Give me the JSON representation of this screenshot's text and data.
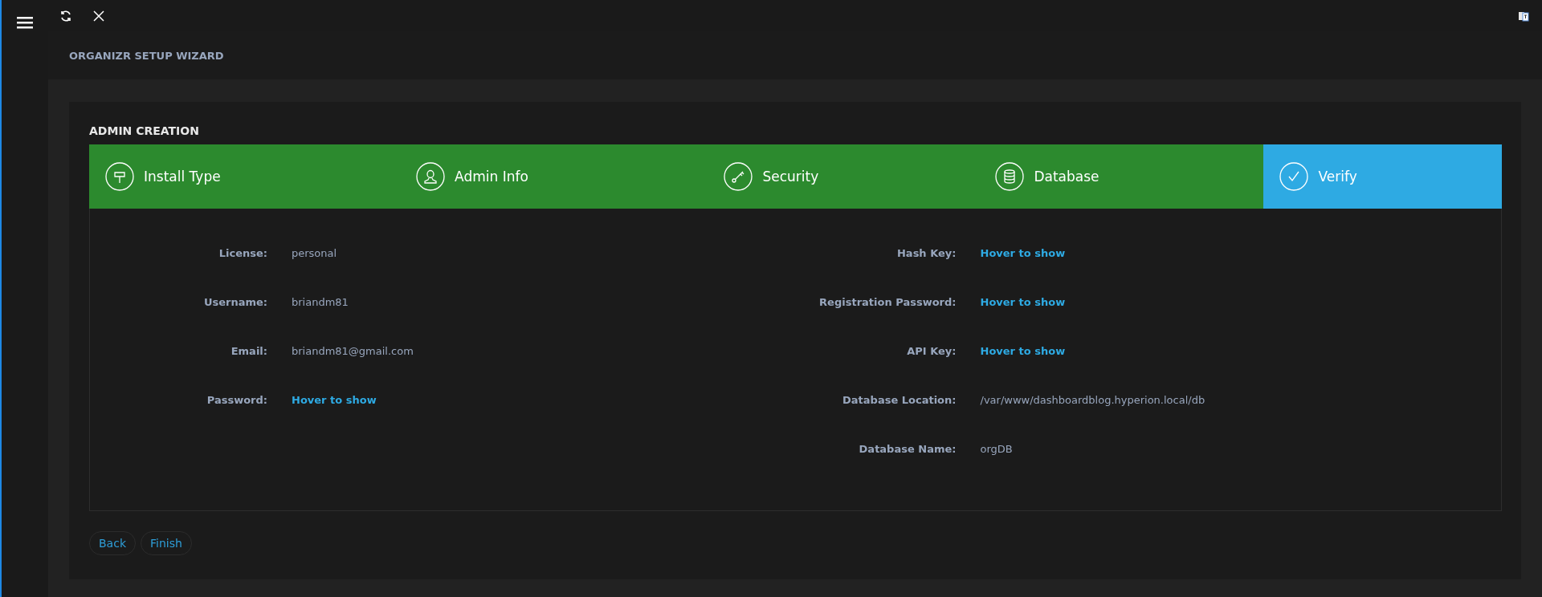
{
  "header": {
    "title": "ORGANIZR SETUP WIZARD"
  },
  "section": {
    "title": "ADMIN CREATION"
  },
  "steps": [
    {
      "label": "Install Type",
      "kind": "sign",
      "selected": false
    },
    {
      "label": "Admin Info",
      "kind": "user",
      "selected": false
    },
    {
      "label": "Security",
      "kind": "key",
      "selected": false
    },
    {
      "label": "Database",
      "kind": "database",
      "selected": false
    },
    {
      "label": "Verify",
      "kind": "check",
      "selected": true
    }
  ],
  "left_fields": [
    {
      "label": "License:",
      "value": "personal",
      "kind": "text"
    },
    {
      "label": "Username:",
      "value": "briandm81",
      "kind": "text"
    },
    {
      "label": "Email:",
      "value": "briandm81@gmail.com",
      "kind": "text"
    },
    {
      "label": "Password:",
      "value": "Hover to show",
      "kind": "hidden"
    }
  ],
  "right_fields": [
    {
      "label": "Hash Key:",
      "value": "Hover to show",
      "kind": "hidden"
    },
    {
      "label": "Registration Password:",
      "value": "Hover to show",
      "kind": "hidden"
    },
    {
      "label": "API Key:",
      "value": "Hover to show",
      "kind": "hidden"
    },
    {
      "label": "Database Location:",
      "value": "/var/www/dashboardblog.hyperion.local/db",
      "kind": "text"
    },
    {
      "label": "Database Name:",
      "value": "orgDB",
      "kind": "text"
    }
  ],
  "buttons": [
    "Back",
    "Finish"
  ]
}
